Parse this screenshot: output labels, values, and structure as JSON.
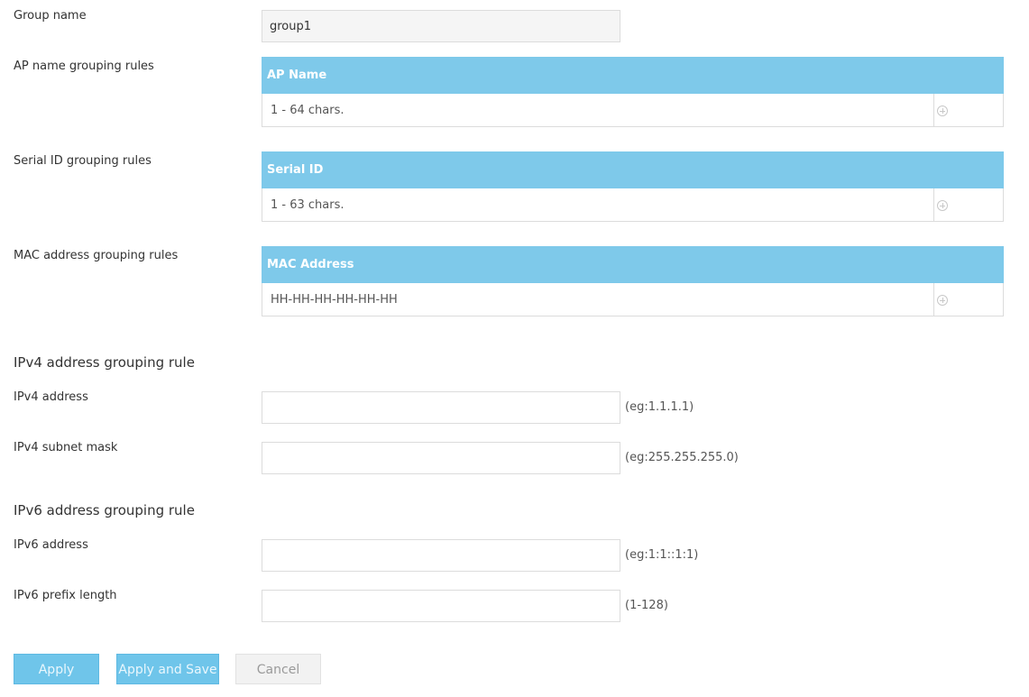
{
  "group_name": {
    "label": "Group name",
    "value": "group1"
  },
  "ap_name_rules": {
    "label": "AP name grouping rules",
    "header": "AP Name",
    "placeholder": "1 - 64 chars.",
    "add_icon": "add-circle-icon"
  },
  "serial_rules": {
    "label": "Serial ID grouping rules",
    "header": "Serial ID",
    "placeholder": "1 - 63 chars.",
    "add_icon": "add-circle-icon"
  },
  "mac_rules": {
    "label": "MAC address grouping rules",
    "header": "MAC Address",
    "placeholder": "HH-HH-HH-HH-HH-HH",
    "add_icon": "add-circle-icon"
  },
  "ipv4": {
    "section_title": "IPv4 address grouping rule",
    "address_label": "IPv4 address",
    "address_value": "",
    "address_hint": "(eg:1.1.1.1)",
    "mask_label": "IPv4 subnet mask",
    "mask_value": "",
    "mask_hint": "(eg:255.255.255.0)"
  },
  "ipv6": {
    "section_title": "IPv6 address grouping rule",
    "address_label": "IPv6 address",
    "address_value": "",
    "address_hint": "(eg:1:1::1:1)",
    "prefix_label": "IPv6 prefix length",
    "prefix_value": "",
    "prefix_hint": "(1-128)"
  },
  "buttons": {
    "apply": "Apply",
    "apply_and_save": "Apply and Save",
    "cancel": "Cancel"
  },
  "colors": {
    "table_header": "#7ec9ea",
    "primary_button": "#6fc5ea",
    "secondary_button": "#f2f2f2"
  }
}
